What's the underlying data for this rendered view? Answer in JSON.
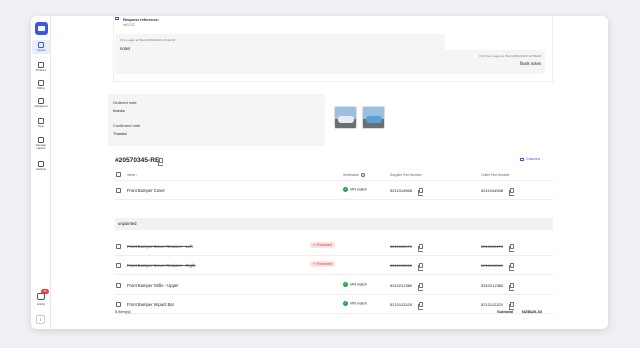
{
  "sidebar": {
    "items": [
      {
        "label": "Quotes",
        "icon": "document-icon",
        "active": true
      },
      {
        "label": "Products",
        "icon": "tag-icon",
        "active": false
      },
      {
        "label": "Billing",
        "icon": "invoice-icon",
        "active": false
      },
      {
        "label": "Intelligence",
        "icon": "users-icon",
        "active": false
      },
      {
        "label": "Sync",
        "icon": "sync-icon",
        "active": false
      },
      {
        "label": "Damage capture",
        "icon": "car-icon",
        "active": false
      },
      {
        "label": "Settings",
        "icon": "gear-icon",
        "active": false
      }
    ],
    "activity_label": "Activity",
    "activity_badge": "99",
    "user_glyph": "i"
  },
  "request": {
    "title": "Request reference:",
    "code": "ref1223"
  },
  "notes": [
    {
      "meta": "Izzy Logan at Wed 28/01/2026 10:41AM",
      "text": "notes"
    },
    {
      "meta": "Izzy Test Logan at Wed 28/01/2026 10:53AM",
      "text": "finals notes"
    }
  ],
  "order": {
    "ordered_label": "Ordered note",
    "ordered_value": "thanks",
    "confirmed_label": "Confirmed note",
    "confirmed_value": "Thanks!"
  },
  "quote": {
    "id": "#20570345-RE",
    "columns_label": "Columns",
    "headers": {
      "items": "Items",
      "verification": "Verification",
      "supplier": "Supplier Part Number",
      "outlet": "Outlet Part Number"
    },
    "rows": [
      {
        "name": "Front Bumper Cover",
        "status": "vin",
        "status_label": "VIN match",
        "supplier": "5211914968",
        "outlet": "5211914968",
        "struck": false
      },
      {
        "name": "Front Bumper Cover Retainer - Left",
        "status": "returned",
        "status_label": "Returned",
        "supplier": "5211612470",
        "outlet": "5211612470",
        "struck": true
      },
      {
        "name": "Front Bumper Cover Retainer - Right",
        "status": "returned",
        "status_label": "Returned",
        "supplier": "5211612520",
        "outlet": "5211612520",
        "struck": true
      },
      {
        "name": "Front Bumper Grille - Upper",
        "status": "vin",
        "status_label": "VIN match",
        "supplier": "5310212380",
        "outlet": "5310212380",
        "struck": false
      },
      {
        "name": "Front Bumper Impact Bar",
        "status": "vin",
        "status_label": "VIN match",
        "supplier": "5213112320",
        "outlet": "5213112320",
        "struck": false
      }
    ],
    "group_label": "unpainted",
    "footer": {
      "count": "5 item(s)",
      "subtotal_label": "Subtotal",
      "subtotal_value": "NZ$626.33"
    }
  },
  "colors": {
    "accent": "#3d5bd9",
    "success": "#23a14a",
    "danger": "#d33333",
    "danger_bg": "#fde2e2"
  }
}
